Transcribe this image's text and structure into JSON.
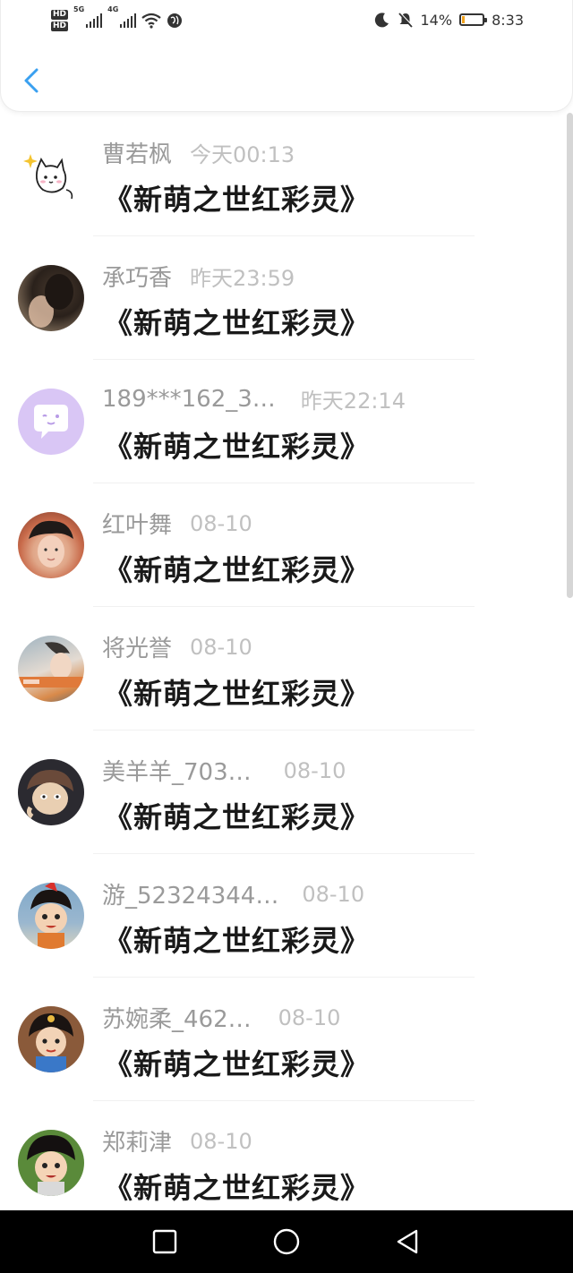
{
  "status_bar": {
    "network_type": "5G",
    "network_type_2": "4G",
    "hd_label": "HD",
    "battery_percent_text": "14%",
    "battery_level": 0.14,
    "time": "8:33"
  },
  "header": {
    "back_icon": "chevron-left-icon",
    "accent_color": "#3aa0f0"
  },
  "list": {
    "message_text": "《新萌之世红彩灵》",
    "items": [
      {
        "name": "曹若枫",
        "time": "今天00:13",
        "avatar": "cat-sticker"
      },
      {
        "name": "承巧香",
        "time": "昨天23:59",
        "avatar": "photo-dark"
      },
      {
        "name": "189***162_3…",
        "time": "昨天22:14",
        "avatar": "chat-bubble-purple"
      },
      {
        "name": "红叶舞",
        "time": "08-10",
        "avatar": "photo-boy"
      },
      {
        "name": "将光誉",
        "time": "08-10",
        "avatar": "photo-boy-2"
      },
      {
        "name": "美羊羊_703…",
        "time": "08-10",
        "avatar": "cartoon-1"
      },
      {
        "name": "游_52324344…",
        "time": "08-10",
        "avatar": "cartoon-2"
      },
      {
        "name": "苏婉柔_462…",
        "time": "08-10",
        "avatar": "cartoon-3"
      },
      {
        "name": "郑莉津",
        "time": "08-10",
        "avatar": "cartoon-4"
      }
    ]
  },
  "nav_bar": {
    "recents_icon": "square-icon",
    "home_icon": "circle-icon",
    "back_icon": "triangle-back-icon"
  }
}
